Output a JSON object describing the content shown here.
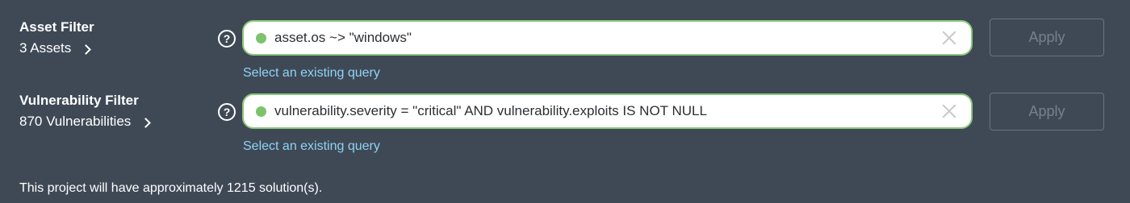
{
  "asset_filter": {
    "title": "Asset Filter",
    "count_label": "3 Assets",
    "help_glyph": "?",
    "query": "asset.os ~> \"windows\"",
    "select_link": "Select an existing query",
    "apply_label": "Apply",
    "status_color": "#7dc36b"
  },
  "vulnerability_filter": {
    "title": "Vulnerability Filter",
    "count_label": "870 Vulnerabilities",
    "help_glyph": "?",
    "query": "vulnerability.severity = \"critical\" AND vulnerability.exploits IS NOT NULL",
    "select_link": "Select an existing query",
    "apply_label": "Apply",
    "status_color": "#7dc36b"
  },
  "footer": {
    "message": "This project will have approximately 1215 solution(s)."
  },
  "icons": {
    "help": "question-circle-icon",
    "clear": "close-icon",
    "expand": "chevron-right-icon",
    "status": "status-dot-icon"
  },
  "colors": {
    "background": "#3f4956",
    "input_border": "#8cc97a",
    "link": "#8fd3f5",
    "apply_disabled_text": "#77808a"
  }
}
